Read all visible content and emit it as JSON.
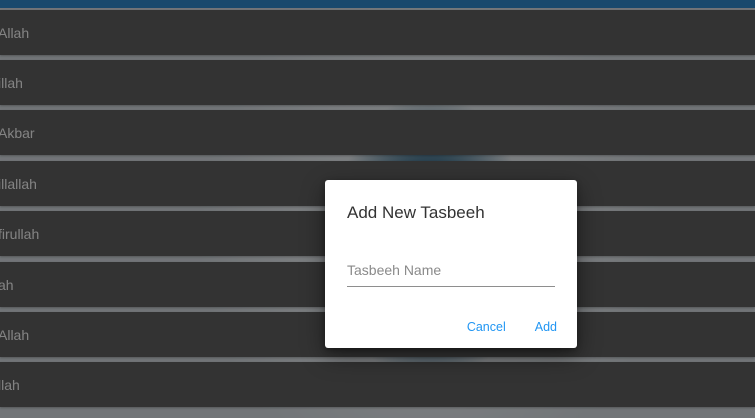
{
  "list": {
    "items": [
      {
        "label": "Allah"
      },
      {
        "label": "illah"
      },
      {
        "label": "Akbar"
      },
      {
        "label": "illallah"
      },
      {
        "label": "firullah"
      },
      {
        "label": "ah"
      },
      {
        "label": "Allah"
      },
      {
        "label": "llah"
      }
    ]
  },
  "dialog": {
    "title": "Add New Tasbeeh",
    "input_placeholder": "Tasbeeh Name",
    "input_value": "",
    "cancel_label": "Cancel",
    "add_label": "Add"
  },
  "colors": {
    "accent": "#2196f3",
    "row_background": "#5e5e5e",
    "top_strip": "#2f86c6"
  }
}
